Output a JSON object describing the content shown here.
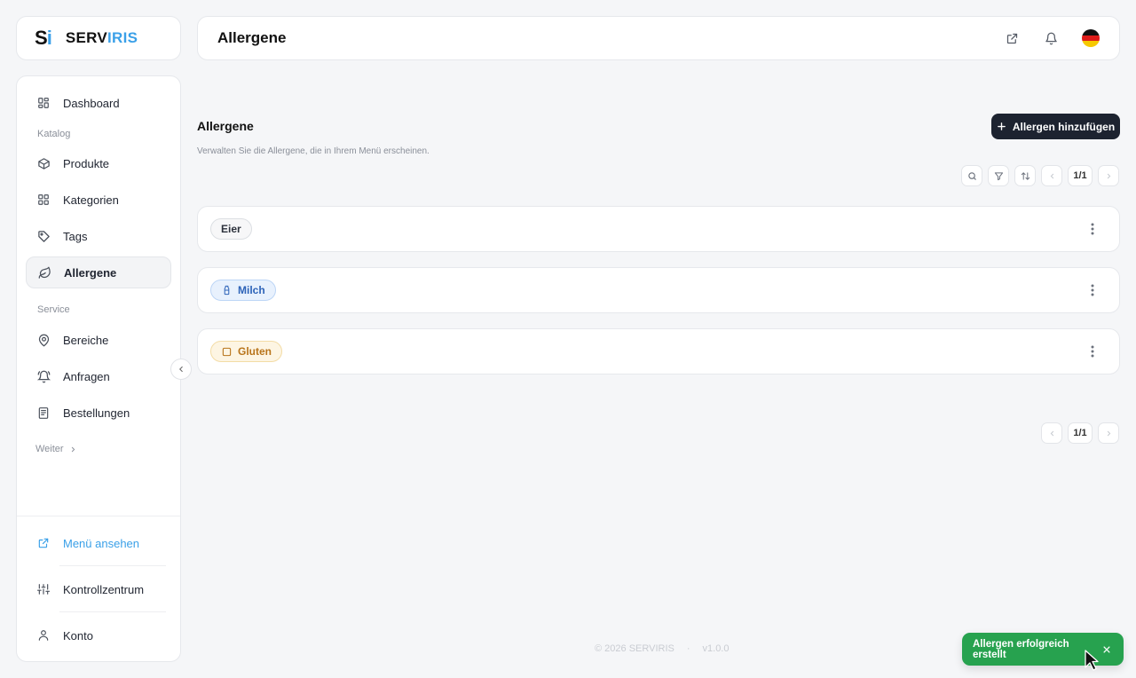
{
  "brand": {
    "mark_s": "S",
    "mark_i": "i",
    "name_main": "SERV",
    "name_accent": "IRIS",
    "accent_color": "#3aa0e8"
  },
  "header": {
    "title": "Allergene",
    "icons": [
      "external-link-icon",
      "bell-icon",
      "german-flag-icon"
    ]
  },
  "sidebar": {
    "items": [
      {
        "label": "Dashboard",
        "icon": "dashboard-icon"
      },
      {
        "label": "Produkte",
        "icon": "box-icon"
      },
      {
        "label": "Kategorien",
        "icon": "grid-icon"
      },
      {
        "label": "Tags",
        "icon": "tag-icon"
      },
      {
        "label": "Allergene",
        "icon": "leaf-icon",
        "active": true
      },
      {
        "label": "Bereiche",
        "icon": "map-pin-icon"
      },
      {
        "label": "Anfragen",
        "icon": "bell-icon"
      },
      {
        "label": "Bestellungen",
        "icon": "receipt-icon"
      }
    ],
    "sections": {
      "catalog": "Katalog",
      "service": "Service"
    },
    "more": "Weiter",
    "bottom": [
      {
        "label": "Menü ansehen",
        "icon": "external-link-icon"
      },
      {
        "label": "Kontrollzentrum",
        "icon": "sliders-icon"
      },
      {
        "label": "Konto",
        "icon": "user-icon"
      }
    ]
  },
  "main": {
    "title": "Allergene",
    "description": "Verwalten Sie die Allergene, die in Ihrem Menü erscheinen.",
    "add_button": "Allergen hinzufügen",
    "pagination": {
      "top": "1/1",
      "bottom": "1/1"
    },
    "allergens": [
      {
        "name": "Eier",
        "style": "neutral"
      },
      {
        "name": "Milch",
        "style": "blue",
        "icon": "milk-bottle-icon"
      },
      {
        "name": "Gluten",
        "style": "amber",
        "icon": "square-icon"
      }
    ]
  },
  "footer": {
    "copyright": "© 2026 SERVIRIS",
    "separator": "·",
    "version": "v1.0.0"
  },
  "toast": {
    "message": "Allergen erfolgreich erstellt",
    "color": "#27a24f"
  }
}
